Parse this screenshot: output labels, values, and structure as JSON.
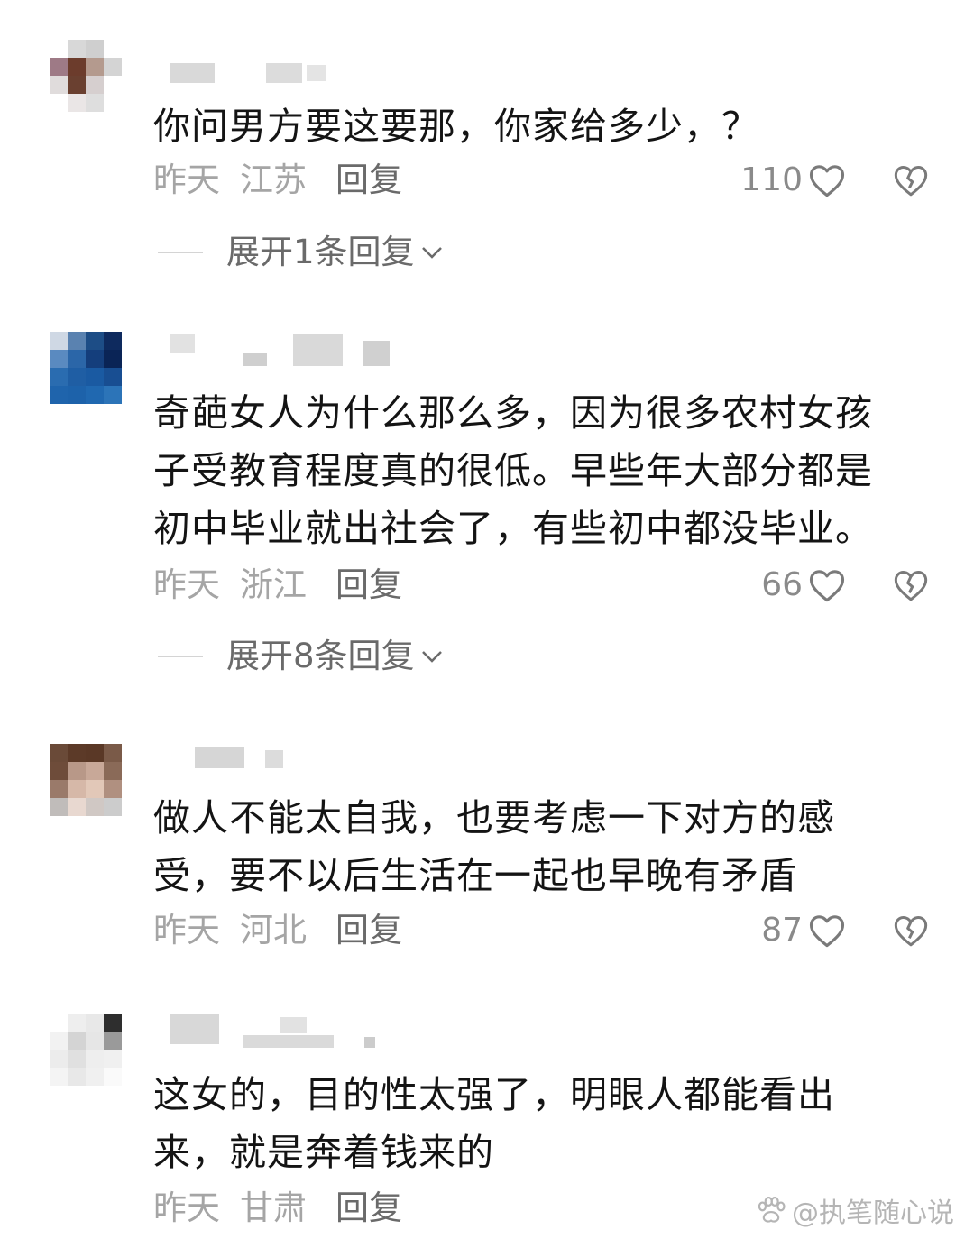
{
  "comments": [
    {
      "text": "你问男方要这要那，你家给多少，？",
      "time": "昨天",
      "location": "江苏",
      "reply_label": "回复",
      "likes": "110",
      "expand_label": "展开1条回复"
    },
    {
      "text": "奇葩女人为什么那么多，因为很多农村女孩\n子受教育程度真的很低。早些年大部分都是\n初中毕业就出社会了，有些初中都没毕业。",
      "time": "昨天",
      "location": "浙江",
      "reply_label": "回复",
      "likes": "66",
      "expand_label": "展开8条回复"
    },
    {
      "text": "做人不能太自我，也要考虑一下对方的感\n受，要不以后生活在一起也早晚有矛盾",
      "time": "昨天",
      "location": "河北",
      "reply_label": "回复",
      "likes": "87"
    },
    {
      "text": "这女的，目的性太强了，明眼人都能看出\n来，就是奔着钱来的",
      "time": "昨天",
      "location": "甘肃",
      "reply_label": "回复"
    }
  ],
  "watermark": "@执笔随心说",
  "colors": {
    "text": "#141414",
    "meta": "#a5a5a5",
    "reply": "#6a6a6a"
  },
  "icons": {
    "like": "heart-outline-icon",
    "dislike": "broken-heart-icon",
    "expand": "chevron-down-icon"
  }
}
